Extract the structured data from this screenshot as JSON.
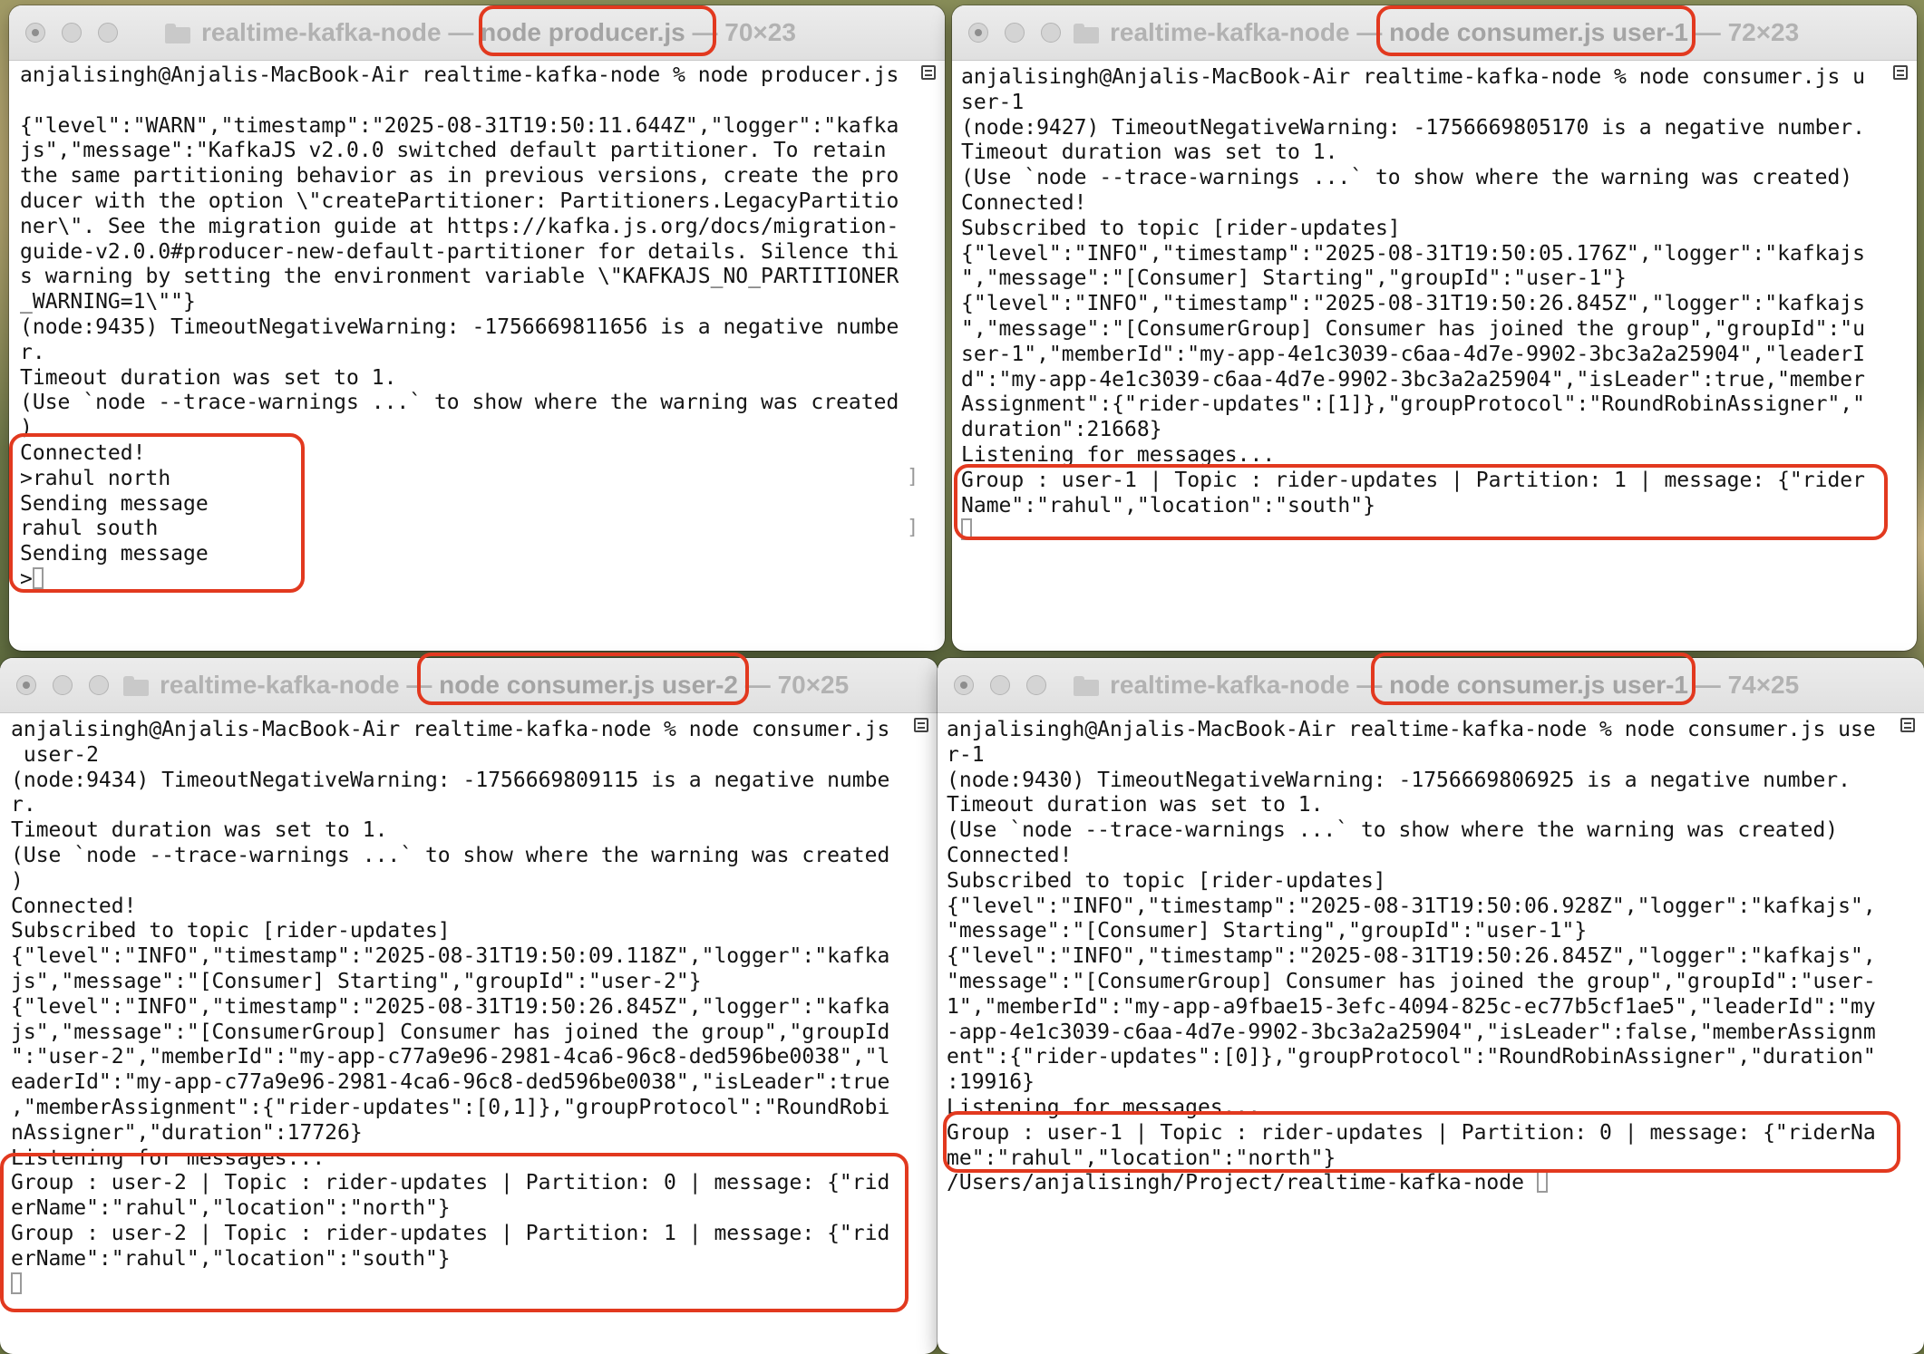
{
  "terminals": [
    {
      "folder": "realtime-kafka-node",
      "separator_1": "—",
      "command": "node producer.js",
      "separator_2": "—",
      "size": "70×23",
      "lines": [
        "anjalisingh@Anjalis-MacBook-Air realtime-kafka-node % node producer.js",
        "",
        "{\"level\":\"WARN\",\"timestamp\":\"2025-08-31T19:50:11.644Z\",\"logger\":\"kafka",
        "js\",\"message\":\"KafkaJS v2.0.0 switched default partitioner. To retain",
        "the same partitioning behavior as in previous versions, create the pro",
        "ducer with the option \\\"createPartitioner: Partitioners.LegacyPartitio",
        "ner\\\". See the migration guide at https://kafka.js.org/docs/migration-",
        "guide-v2.0.0#producer-new-default-partitioner for details. Silence thi",
        "s warning by setting the environment variable \\\"KAFKAJS_NO_PARTITIONER",
        "_WARNING=1\\\"\"}",
        "(node:9435) TimeoutNegativeWarning: -1756669811656 is a negative numbe",
        "r.",
        "Timeout duration was set to 1.",
        "(Use `node --trace-warnings ...` to show where the warning was created",
        ")",
        "Connected!",
        ">rahul north",
        "Sending message",
        "rahul south",
        "Sending message",
        ">"
      ]
    },
    {
      "folder": "realtime-kafka-node",
      "separator_1": "—",
      "command": "node consumer.js user-1",
      "separator_2": "—",
      "size": "72×23",
      "lines": [
        "anjalisingh@Anjalis-MacBook-Air realtime-kafka-node % node consumer.js u",
        "ser-1",
        "(node:9427) TimeoutNegativeWarning: -1756669805170 is a negative number.",
        "Timeout duration was set to 1.",
        "(Use `node --trace-warnings ...` to show where the warning was created)",
        "Connected!",
        "Subscribed to topic [rider-updates]",
        "{\"level\":\"INFO\",\"timestamp\":\"2025-08-31T19:50:05.176Z\",\"logger\":\"kafkajs",
        "\",\"message\":\"[Consumer] Starting\",\"groupId\":\"user-1\"}",
        "{\"level\":\"INFO\",\"timestamp\":\"2025-08-31T19:50:26.845Z\",\"logger\":\"kafkajs",
        "\",\"message\":\"[ConsumerGroup] Consumer has joined the group\",\"groupId\":\"u",
        "ser-1\",\"memberId\":\"my-app-4e1c3039-c6aa-4d7e-9902-3bc3a2a25904\",\"leaderI",
        "d\":\"my-app-4e1c3039-c6aa-4d7e-9902-3bc3a2a25904\",\"isLeader\":true,\"member",
        "Assignment\":{\"rider-updates\":[1]},\"groupProtocol\":\"RoundRobinAssigner\",\"",
        "duration\":21668}",
        "Listening for messages...",
        "Group : user-1 | Topic : rider-updates | Partition: 1 | message: {\"rider",
        "Name\":\"rahul\",\"location\":\"south\"}",
        ""
      ]
    },
    {
      "folder": "realtime-kafka-node",
      "separator_1": "—",
      "command": "node consumer.js user-2",
      "separator_2": "—",
      "size": "70×25",
      "lines": [
        "anjalisingh@Anjalis-MacBook-Air realtime-kafka-node % node consumer.js",
        " user-2",
        "(node:9434) TimeoutNegativeWarning: -1756669809115 is a negative numbe",
        "r.",
        "Timeout duration was set to 1.",
        "(Use `node --trace-warnings ...` to show where the warning was created",
        ")",
        "Connected!",
        "Subscribed to topic [rider-updates]",
        "{\"level\":\"INFO\",\"timestamp\":\"2025-08-31T19:50:09.118Z\",\"logger\":\"kafka",
        "js\",\"message\":\"[Consumer] Starting\",\"groupId\":\"user-2\"}",
        "{\"level\":\"INFO\",\"timestamp\":\"2025-08-31T19:50:26.845Z\",\"logger\":\"kafka",
        "js\",\"message\":\"[ConsumerGroup] Consumer has joined the group\",\"groupId",
        "\":\"user-2\",\"memberId\":\"my-app-c77a9e96-2981-4ca6-96c8-ded596be0038\",\"l",
        "eaderId\":\"my-app-c77a9e96-2981-4ca6-96c8-ded596be0038\",\"isLeader\":true",
        ",\"memberAssignment\":{\"rider-updates\":[0,1]},\"groupProtocol\":\"RoundRobi",
        "nAssigner\",\"duration\":17726}",
        "Listening for messages...",
        "Group : user-2 | Topic : rider-updates | Partition: 0 | message: {\"rid",
        "erName\":\"rahul\",\"location\":\"north\"}",
        "Group : user-2 | Topic : rider-updates | Partition: 1 | message: {\"rid",
        "erName\":\"rahul\",\"location\":\"south\"}",
        ""
      ]
    },
    {
      "folder": "realtime-kafka-node",
      "separator_1": "—",
      "command": "node consumer.js user-1",
      "separator_2": "—",
      "size": "74×25",
      "lines": [
        "anjalisingh@Anjalis-MacBook-Air realtime-kafka-node % node consumer.js use",
        "r-1",
        "(node:9430) TimeoutNegativeWarning: -1756669806925 is a negative number.",
        "Timeout duration was set to 1.",
        "(Use `node --trace-warnings ...` to show where the warning was created)",
        "Connected!",
        "Subscribed to topic [rider-updates]",
        "{\"level\":\"INFO\",\"timestamp\":\"2025-08-31T19:50:06.928Z\",\"logger\":\"kafkajs\",",
        "\"message\":\"[Consumer] Starting\",\"groupId\":\"user-1\"}",
        "{\"level\":\"INFO\",\"timestamp\":\"2025-08-31T19:50:26.845Z\",\"logger\":\"kafkajs\",",
        "\"message\":\"[ConsumerGroup] Consumer has joined the group\",\"groupId\":\"user-",
        "1\",\"memberId\":\"my-app-a9fbae15-3efc-4094-825c-ec77b5cf1ae5\",\"leaderId\":\"my",
        "-app-4e1c3039-c6aa-4d7e-9902-3bc3a2a25904\",\"isLeader\":false,\"memberAssignm",
        "ent\":{\"rider-updates\":[0]},\"groupProtocol\":\"RoundRobinAssigner\",\"duration\"",
        ":19916}",
        "Listening for messages...",
        "Group : user-1 | Topic : rider-updates | Partition: 0 | message: {\"riderNa",
        "me\":\"rahul\",\"location\":\"north\"}",
        "/Users/anjalisingh/Project/realtime-kafka-node "
      ]
    }
  ],
  "colors": {
    "highlight": "#e2391f",
    "title_text": "#b2b2b2",
    "terminal_text": "#141414",
    "terminal_bg": "#ffffff"
  }
}
